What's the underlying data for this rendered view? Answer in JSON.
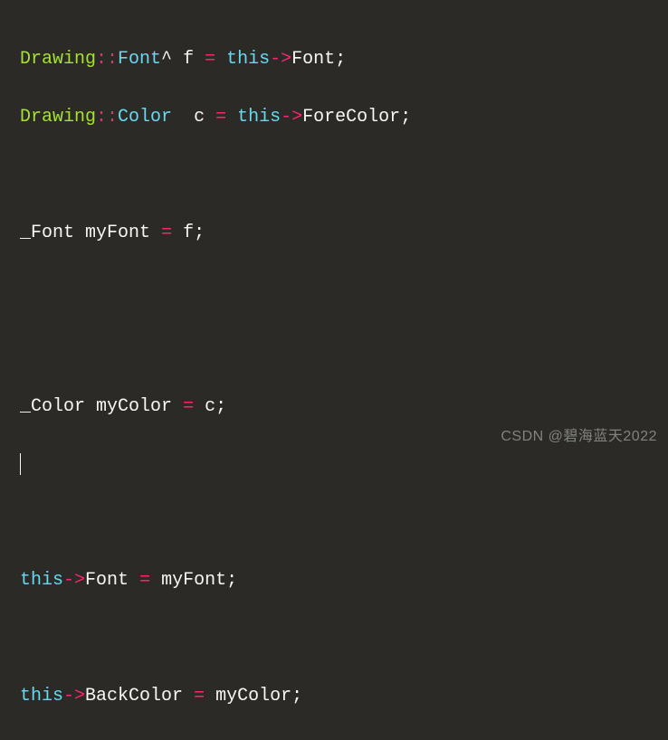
{
  "code": {
    "line1": {
      "ns": "Drawing",
      "scope": "::",
      "type": "Font",
      "hat": "^",
      "sp1": " ",
      "var": "f",
      "sp2": " ",
      "assign": "=",
      "sp3": " ",
      "this": "this",
      "arrow": "->",
      "prop": "Font",
      "semi": ";"
    },
    "line2": {
      "ns": "Drawing",
      "scope": "::",
      "type": "Color",
      "sp1": "  ",
      "var": "c",
      "sp2": " ",
      "assign": "=",
      "sp3": " ",
      "this": "this",
      "arrow": "->",
      "prop": "ForeColor",
      "semi": ";"
    },
    "line4": {
      "type": "_Font",
      "sp1": " ",
      "var": "myFont",
      "sp2": " ",
      "assign": "=",
      "sp3": " ",
      "rhs": "f",
      "semi": ";"
    },
    "line7": {
      "type": "_Color",
      "sp1": " ",
      "var": "myColor",
      "sp2": " ",
      "assign": "=",
      "sp3": " ",
      "rhs": "c",
      "semi": ";"
    },
    "line10": {
      "this": "this",
      "arrow": "->",
      "prop": "Font",
      "sp1": " ",
      "assign": "=",
      "sp2": " ",
      "rhs": "myFont",
      "semi": ";"
    },
    "line12": {
      "this": "this",
      "arrow": "->",
      "prop": "BackColor",
      "sp1": " ",
      "assign": "=",
      "sp2": " ",
      "rhs": "myColor",
      "semi": ";"
    }
  },
  "watermark": "CSDN @碧海蓝天2022"
}
